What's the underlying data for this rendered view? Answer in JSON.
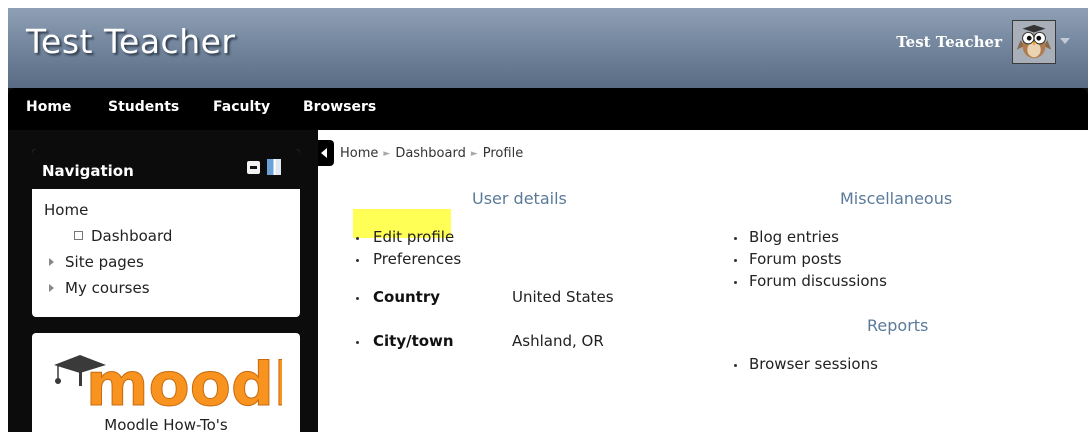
{
  "header": {
    "site_title": "Test Teacher",
    "user_name": "Test Teacher",
    "avatar_icon": "owl-avatar-icon",
    "menu_icon": "chevron-down-icon"
  },
  "navbar": {
    "items": [
      {
        "label": "Home"
      },
      {
        "label": "Students"
      },
      {
        "label": "Faculty"
      },
      {
        "label": "Browsers"
      }
    ]
  },
  "navigation_block": {
    "title": "Navigation",
    "controls": [
      "hide-icon",
      "dock-icon"
    ],
    "tree": [
      {
        "label": "Home"
      },
      {
        "label": "Dashboard"
      },
      {
        "label": "Site pages"
      },
      {
        "label": "My courses"
      }
    ]
  },
  "moodle_block": {
    "logo_text": "moodle",
    "caption": "Moodle How-To's"
  },
  "breadcrumb": {
    "items": [
      "Home",
      "Dashboard",
      "Profile"
    ],
    "separator": "►"
  },
  "user_details": {
    "title": "User details",
    "links": [
      {
        "label": "Edit profile",
        "highlighted": true
      },
      {
        "label": "Preferences",
        "highlighted": false
      }
    ],
    "fields": [
      {
        "label": "Country",
        "value": "United States"
      },
      {
        "label": "City/town",
        "value": "Ashland, OR"
      }
    ]
  },
  "miscellaneous": {
    "title": "Miscellaneous",
    "links": [
      "Blog entries",
      "Forum posts",
      "Forum discussions"
    ]
  },
  "reports": {
    "title": "Reports",
    "links": [
      "Browser sessions"
    ]
  },
  "colors": {
    "header_gradient_top": "#8fa0b6",
    "header_gradient_bottom": "#5a6c83",
    "navbar": "#000000",
    "section_title": "#5b7a9a",
    "highlight": "#ffff55",
    "moodle_orange": "#f7931e"
  }
}
